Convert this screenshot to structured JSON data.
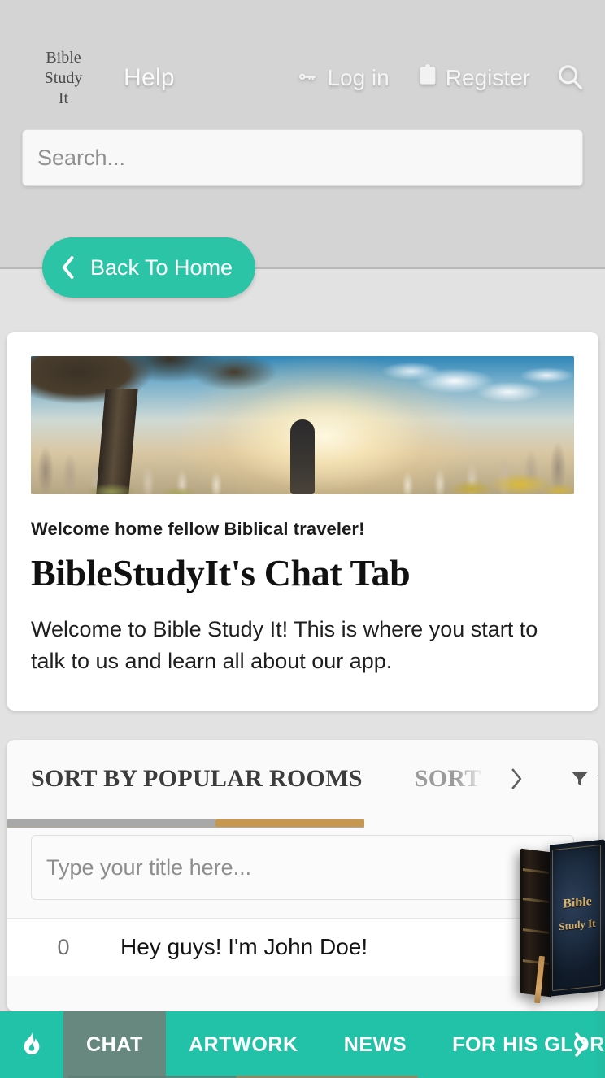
{
  "header": {
    "brand_lines": [
      "Bible",
      "Study",
      "It"
    ],
    "help_label": "Help",
    "login_label": "Log in",
    "register_label": "Register",
    "login_icon": "key-icon",
    "register_icon": "clipboard-icon",
    "search_icon": "search-icon",
    "search_placeholder": "Search...",
    "search_value": ""
  },
  "back_button": {
    "label": "Back To Home",
    "icon": "chevron-left-icon",
    "color": "#2bc4a7"
  },
  "welcome_card": {
    "hero_alt": "biblical-sunset-crowd-hero-image",
    "eyebrow": "Welcome home fellow Biblical traveler!",
    "title": "BibleStudyIt's Chat Tab",
    "body": "Welcome to Bible Study It! This is where you start to talk to us and learn all about our app."
  },
  "list_card": {
    "sort_tab_active": "SORT BY POPULAR ROOMS",
    "sort_tab_next": "SORT",
    "next_icon": "chevron-right-icon",
    "filter_icon": "funnel-icon",
    "filter_caret_icon": "caret-down-icon",
    "scroll_segment_gray": "#a8a8a8",
    "scroll_segment_gold": "#c8974f",
    "title_input_placeholder": "Type your title here...",
    "title_input_value": "",
    "rows": [
      {
        "count": "0",
        "text": "Hey guys! I'm John Doe!"
      }
    ]
  },
  "book_badge": {
    "cover_line1": "Bible",
    "cover_line2": "Study It",
    "alt": "bible-study-it-book"
  },
  "tabbar": {
    "flame_icon": "flame-icon",
    "background": "#21c2a8",
    "active_background": "#66887f",
    "tabs": [
      {
        "label": "CHAT",
        "active": true
      },
      {
        "label": "ARTWORK",
        "active": false
      },
      {
        "label": "NEWS",
        "active": false
      },
      {
        "label": "FOR HIS GLORY (PA",
        "active": false
      }
    ],
    "next_icon": "chevron-right-icon"
  }
}
